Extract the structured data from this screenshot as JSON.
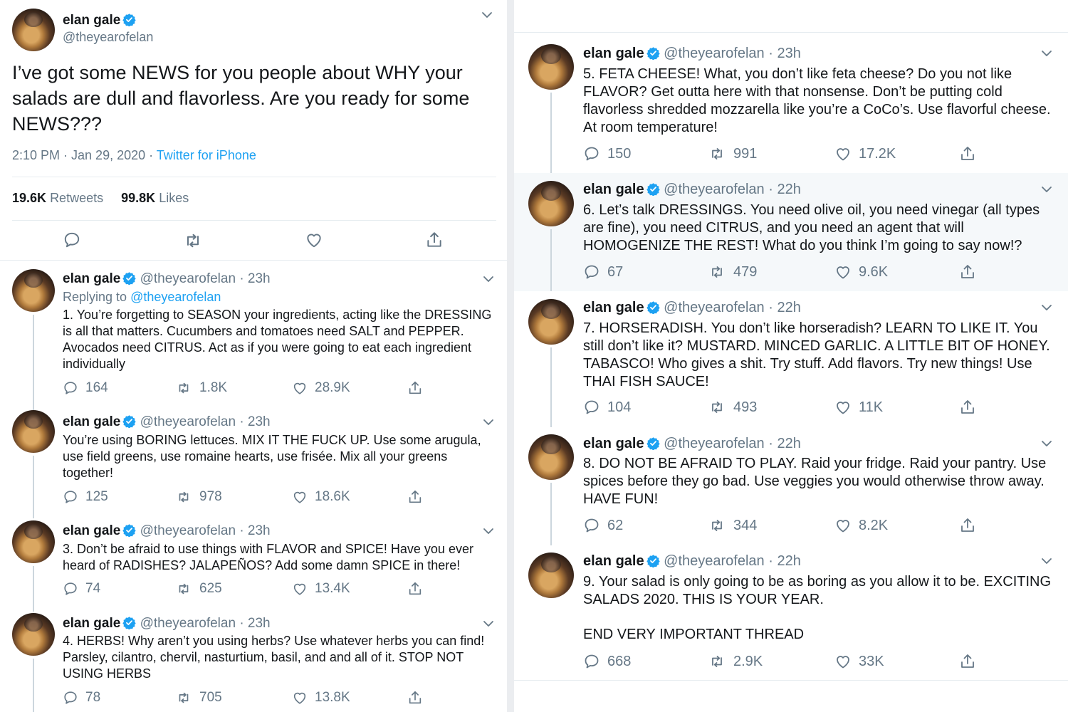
{
  "main": {
    "name": "elan gale",
    "handle": "@theyearofelan",
    "text": "I’ve got some NEWS for you people about WHY your salads are dull and flavorless. Are you ready for some NEWS???",
    "time": "2:10 PM · Jan 29, 2020 · ",
    "source": "Twitter for iPhone",
    "retweets_count": "19.6K",
    "retweets_label": "Retweets",
    "likes_count": "99.8K",
    "likes_label": "Likes"
  },
  "replies": [
    {
      "name": "elan gale",
      "handle": "@theyearofelan · 23h",
      "replying_prefix": "Replying to ",
      "replying_to": "@theyearofelan",
      "text": "1. You’re forgetting to SEASON your ingredients, acting like the DRESSING is all that matters. Cucumbers and tomatoes need SALT and PEPPER. Avocados need CITRUS. Act as if you were going to eat each ingredient individually",
      "replies": "164",
      "retweets": "1.8K",
      "likes": "28.9K"
    },
    {
      "name": "elan gale",
      "handle": "@theyearofelan · 23h",
      "text": "You’re using BORING lettuces. MIX IT THE FUCK UP. Use some arugula, use field greens, use romaine hearts, use frisée. Mix all your greens together!",
      "replies": "125",
      "retweets": "978",
      "likes": "18.6K"
    },
    {
      "name": "elan gale",
      "handle": "@theyearofelan · 23h",
      "text": "3. Don’t be afraid to use things with FLAVOR and SPICE! Have you ever heard of RADISHES? JALAPEÑOS? Add some damn SPICE in there!",
      "replies": "74",
      "retweets": "625",
      "likes": "13.4K"
    },
    {
      "name": "elan gale",
      "handle": "@theyearofelan · 23h",
      "text": "4. HERBS! Why aren’t you using herbs? Use whatever herbs you can find! Parsley, cilantro, chervil, nasturtium, basil, and and all of it. STOP NOT USING HERBS",
      "replies": "78",
      "retweets": "705",
      "likes": "13.8K"
    },
    {
      "name": "elan gale",
      "handle": "@theyearofelan · 23h",
      "text": "5. FETA CHEESE! What, you don’t like feta cheese? Do you not like FLAVOR? Get outta here with that nonsense. Don’t be putting cold flavorless shredded mozzarella like you’re a CoCo’s. Use flavorful cheese. At room temperature!",
      "replies": "150",
      "retweets": "991",
      "likes": "17.2K"
    },
    {
      "name": "elan gale",
      "handle": "@theyearofelan · 22h",
      "text": "6. Let’s talk DRESSINGS. You need olive oil, you need vinegar (all types are fine), you need CITRUS, and you need an agent that will HOMOGENIZE THE REST! What do you think I’m going to say now!?",
      "replies": "67",
      "retweets": "479",
      "likes": "9.6K"
    },
    {
      "name": "elan gale",
      "handle": "@theyearofelan · 22h",
      "text": "7. HORSERADISH. You don’t like horseradish? LEARN TO LIKE IT. You still don’t like it? MUSTARD. MINCED GARLIC. A LITTLE BIT OF HONEY. TABASCO! Who gives a shit. Try stuff. Add flavors. Try new things! Use THAI FISH SAUCE!",
      "replies": "104",
      "retweets": "493",
      "likes": "11K"
    },
    {
      "name": "elan gale",
      "handle": "@theyearofelan · 22h",
      "text": "8. DO NOT BE AFRAID TO PLAY. Raid your fridge. Raid your pantry. Use spices before they go bad. Use veggies you would otherwise throw away. HAVE FUN!",
      "replies": "62",
      "retweets": "344",
      "likes": "8.2K"
    },
    {
      "name": "elan gale",
      "handle": "@theyearofelan · 22h",
      "text": "9. Your salad is only going to be as boring as you allow it to be. EXCITING SALADS 2020. THIS IS YOUR YEAR.",
      "text2": "END VERY IMPORTANT THREAD",
      "replies": "668",
      "retweets": "2.9K",
      "likes": "33K"
    }
  ],
  "colors": {
    "accent": "#1da1f2",
    "muted": "#657786",
    "text": "#14171a",
    "divider": "#e6ecf0"
  }
}
